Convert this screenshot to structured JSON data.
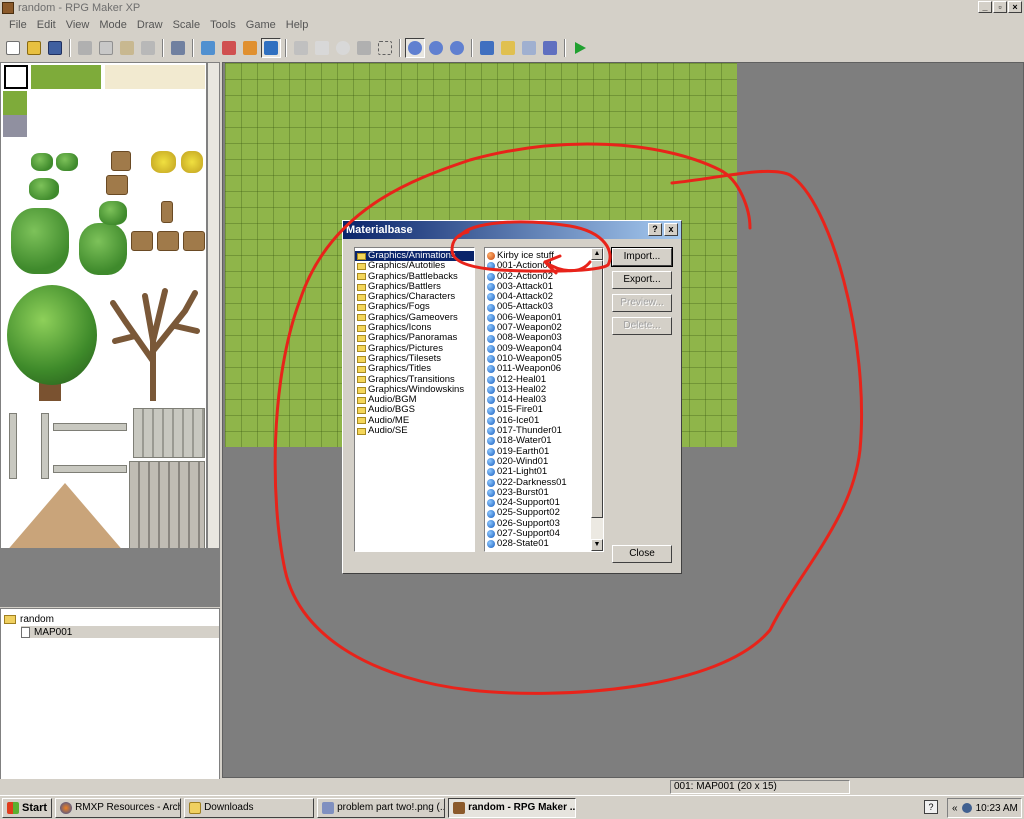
{
  "window": {
    "title": "random - RPG Maker XP"
  },
  "menu": [
    "File",
    "Edit",
    "View",
    "Mode",
    "Draw",
    "Scale",
    "Tools",
    "Game",
    "Help"
  ],
  "maptree": {
    "project": "random",
    "maps": [
      "MAP001"
    ]
  },
  "dialog": {
    "title": "Materialbase",
    "help_btn": "?",
    "close_btn": "x",
    "folders": [
      "Graphics/Animations",
      "Graphics/Autotiles",
      "Graphics/Battlebacks",
      "Graphics/Battlers",
      "Graphics/Characters",
      "Graphics/Fogs",
      "Graphics/Gameovers",
      "Graphics/Icons",
      "Graphics/Panoramas",
      "Graphics/Pictures",
      "Graphics/Tilesets",
      "Graphics/Titles",
      "Graphics/Transitions",
      "Graphics/Windowskins",
      "Audio/BGM",
      "Audio/BGS",
      "Audio/ME",
      "Audio/SE"
    ],
    "selected_folder": "Graphics/Animations",
    "files": [
      "Kirby ice stuff",
      "001-Action01",
      "002-Action02",
      "003-Attack01",
      "004-Attack02",
      "005-Attack03",
      "006-Weapon01",
      "007-Weapon02",
      "008-Weapon03",
      "009-Weapon04",
      "010-Weapon05",
      "011-Weapon06",
      "012-Heal01",
      "013-Heal02",
      "014-Heal03",
      "015-Fire01",
      "016-Ice01",
      "017-Thunder01",
      "018-Water01",
      "019-Earth01",
      "020-Wind01",
      "021-Light01",
      "022-Darkness01",
      "023-Burst01",
      "024-Support01",
      "025-Support02",
      "026-Support03",
      "027-Support04",
      "028-State01"
    ],
    "buttons": {
      "import": "Import...",
      "export": "Export...",
      "preview": "Preview...",
      "delete": "Delete...",
      "close": "Close"
    }
  },
  "status": {
    "map_info": "001: MAP001 (20 x 15)"
  },
  "taskbar": {
    "start": "Start",
    "tasks": [
      "RMXP Resources - Archiv...",
      "Downloads",
      "problem part two!.png (...",
      "random - RPG Maker ..."
    ],
    "help": "?",
    "tray_chevron": "«",
    "clock": "10:23 AM"
  },
  "colors": {
    "annotation": "#e8231a",
    "title_bar": "#0a246a",
    "grass": "#8fb54a"
  }
}
